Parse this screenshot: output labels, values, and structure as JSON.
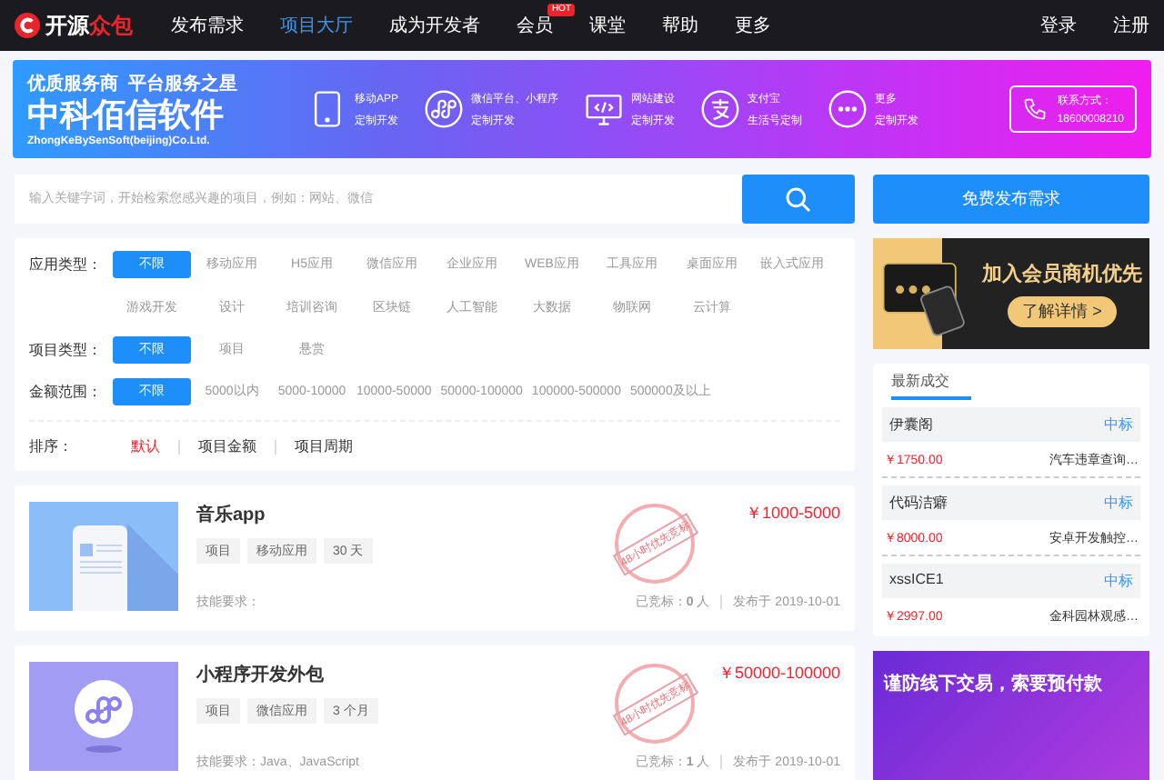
{
  "nav": {
    "logo_main": "开源",
    "logo_accent": "众包",
    "items": [
      {
        "label": "发布需求",
        "selected": false
      },
      {
        "label": "项目大厅",
        "selected": true
      },
      {
        "label": "成为开发者",
        "selected": false
      },
      {
        "label": "会员",
        "selected": false,
        "badge": "HOT"
      },
      {
        "label": "课堂",
        "selected": false
      },
      {
        "label": "帮助",
        "selected": false
      },
      {
        "label": "更多",
        "selected": false
      }
    ],
    "actions": [
      "登录",
      "注册"
    ]
  },
  "banner": {
    "slogan": "优质服务商  平台服务之星",
    "company": "中科佰信软件",
    "company_en": "ZhongKeBySenSoft(beijing)Co.Ltd.",
    "services": [
      {
        "kind": "phone",
        "line1": "移动APP",
        "line2": "定制开发"
      },
      {
        "kind": "miniapp",
        "line1": "微信平台、小程序",
        "line2": "定制开发"
      },
      {
        "kind": "monitor",
        "line1": "网站建设",
        "line2": "定制开发"
      },
      {
        "kind": "alipay",
        "line1": "支付宝",
        "line2": "生活号定制"
      },
      {
        "kind": "more",
        "line1": "更多",
        "line2": "定制开发"
      }
    ],
    "contact": {
      "label": "联系方式：",
      "phone": "18600008210"
    }
  },
  "search": {
    "placeholder": "输入关键字词，开始检索您感兴趣的项目，例如：网站、微信",
    "publish_button": "免费发布需求"
  },
  "filters": [
    {
      "label": "应用类型：",
      "options": [
        {
          "label": "不限",
          "selected": true
        },
        {
          "label": "移动应用",
          "selected": false
        },
        {
          "label": "H5应用",
          "selected": false
        },
        {
          "label": "微信应用",
          "selected": false
        },
        {
          "label": "企业应用",
          "selected": false
        },
        {
          "label": "WEB应用",
          "selected": false
        },
        {
          "label": "工具应用",
          "selected": false
        },
        {
          "label": "桌面应用",
          "selected": false
        },
        {
          "label": "嵌入式应用",
          "selected": false
        },
        {
          "label": "游戏开发",
          "selected": false
        },
        {
          "label": "设计",
          "selected": false
        },
        {
          "label": "培训咨询",
          "selected": false
        },
        {
          "label": "区块链",
          "selected": false
        },
        {
          "label": "人工智能",
          "selected": false
        },
        {
          "label": "大数据",
          "selected": false
        },
        {
          "label": "物联网",
          "selected": false
        },
        {
          "label": "云计算",
          "selected": false
        }
      ]
    },
    {
      "label": "项目类型：",
      "options": [
        {
          "label": "不限",
          "selected": true
        },
        {
          "label": "项目",
          "selected": false
        },
        {
          "label": "悬赏",
          "selected": false
        }
      ]
    },
    {
      "label": "金额范围：",
      "options": [
        {
          "label": "不限",
          "selected": true
        },
        {
          "label": "5000以内",
          "selected": false
        },
        {
          "label": "5000-10000",
          "selected": false
        },
        {
          "label": "10000-50000",
          "selected": false
        },
        {
          "label": "50000-100000",
          "selected": false
        },
        {
          "label": "100000-500000",
          "selected": false
        },
        {
          "label": "500000及以上",
          "selected": false
        }
      ]
    }
  ],
  "sort": {
    "label": "排序：",
    "options": [
      {
        "label": "默认",
        "selected": true
      },
      {
        "label": "项目金额",
        "selected": false
      },
      {
        "label": "项目周期",
        "selected": false
      }
    ]
  },
  "projects": [
    {
      "kind": "phone",
      "title": "音乐app",
      "tags": [
        "项目",
        "移动应用",
        "30 天"
      ],
      "skills": "技能要求：",
      "stamp": "48小时优先竞标",
      "price": "￥1000-5000",
      "bids": "已竞标：**0** 人",
      "date": "发布于  2019-10-01"
    },
    {
      "kind": "miniapp",
      "title": "小程序开发外包",
      "tags": [
        "项目",
        "微信应用",
        "3 个月"
      ],
      "skills": "技能要求：Java、JavaScript",
      "stamp": "48小时优先竞标",
      "price": "￥50000-100000",
      "bids": "已竞标：**1** 人",
      "date": "发布于  2019-10-01"
    }
  ],
  "member_ad": {
    "headline": "加入会员商机优先",
    "button": "了解详情 >"
  },
  "deals": {
    "tab": "最新成交",
    "items": [
      {
        "name": "伊囊阁",
        "status": "中标",
        "price": "￥1750.00",
        "project": "汽车违章查询…"
      },
      {
        "name": "代码洁癖",
        "status": "中标",
        "price": "￥8000.00",
        "project": "安卓开发触控…"
      },
      {
        "name": "xssICE1",
        "status": "中标",
        "price": "￥2997.00",
        "project": "金科园林观感…"
      }
    ]
  },
  "warning_ad": {
    "headline": "谨防线下交易，索要预付款"
  }
}
